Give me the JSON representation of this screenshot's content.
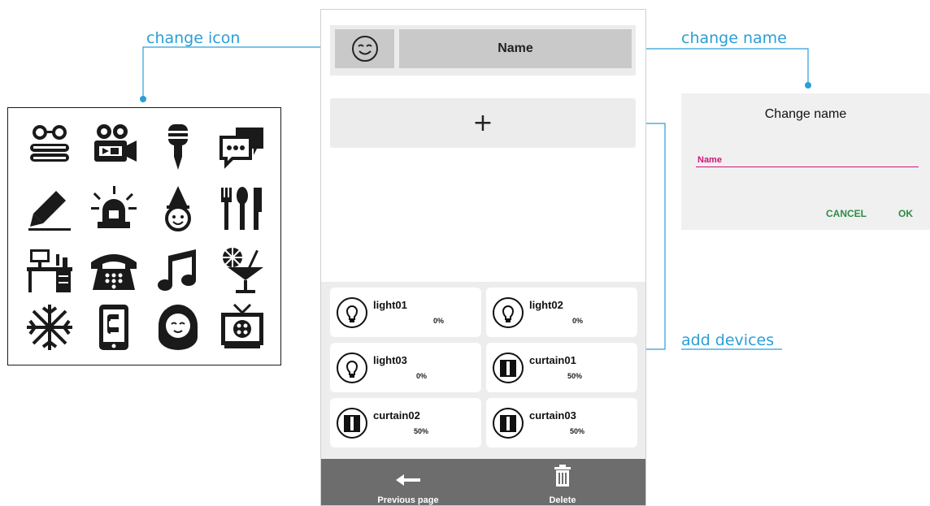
{
  "callouts": {
    "change_icon": "change icon",
    "change_name": "change name",
    "add_devices": "add devices"
  },
  "icon_picker": {
    "icons": [
      "books-glasses-icon",
      "video-camera-icon",
      "microphone-icon",
      "chat-bubbles-icon",
      "pencil-icon",
      "siren-icon",
      "party-hat-face-icon",
      "cutlery-icon",
      "desk-computer-icon",
      "telephone-icon",
      "music-note-icon",
      "cocktail-icon",
      "snowflake-icon",
      "phone-tablet-icon",
      "baby-icon",
      "television-icon"
    ]
  },
  "phone": {
    "header": {
      "icon": "smiley-icon",
      "name_label": "Name"
    },
    "add_label": "+",
    "devices": [
      {
        "name": "light01",
        "value": "0%",
        "icon": "bulb-icon"
      },
      {
        "name": "light02",
        "value": "0%",
        "icon": "bulb-icon"
      },
      {
        "name": "light03",
        "value": "0%",
        "icon": "bulb-icon"
      },
      {
        "name": "curtain01",
        "value": "50%",
        "icon": "curtain-icon"
      },
      {
        "name": "curtain02",
        "value": "50%",
        "icon": "curtain-icon"
      },
      {
        "name": "curtain03",
        "value": "50%",
        "icon": "curtain-icon"
      }
    ],
    "footer": {
      "previous_label": "Previous page",
      "delete_label": "Delete"
    }
  },
  "dialog": {
    "title": "Change name",
    "field_value": "Name",
    "cancel_label": "CANCEL",
    "ok_label": "OK"
  },
  "colors": {
    "callout": "#2a9fd6",
    "accent_field": "#d0147a",
    "dialog_button": "#2e8b47",
    "footer": "#6d6d6d"
  }
}
